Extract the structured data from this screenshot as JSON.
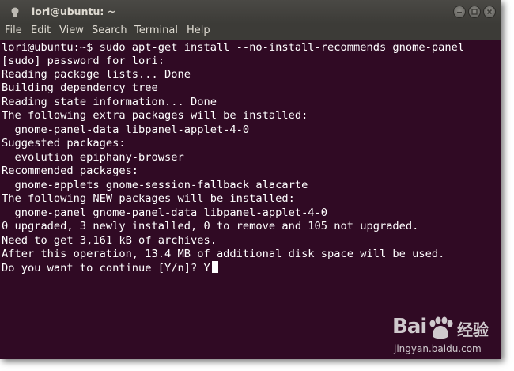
{
  "window": {
    "title": "lori@ubuntu: ~",
    "buttons": {
      "minimize": "minimize-icon",
      "maximize": "maximize-icon",
      "close": "close-icon"
    }
  },
  "menu": [
    "File",
    "Edit",
    "View",
    "Search",
    "Terminal",
    "Help"
  ],
  "terminal": {
    "lines": [
      "lori@ubuntu:~$ sudo apt-get install --no-install-recommends gnome-panel",
      "[sudo] password for lori:",
      "Reading package lists... Done",
      "Building dependency tree",
      "Reading state information... Done",
      "The following extra packages will be installed:",
      "  gnome-panel-data libpanel-applet-4-0",
      "Suggested packages:",
      "  evolution epiphany-browser",
      "Recommended packages:",
      "  gnome-applets gnome-session-fallback alacarte",
      "The following NEW packages will be installed:",
      "  gnome-panel gnome-panel-data libpanel-applet-4-0",
      "0 upgraded, 3 newly installed, 0 to remove and 105 not upgraded.",
      "Need to get 3,161 kB of archives.",
      "After this operation, 13.4 MB of additional disk space will be used.",
      "Do you want to continue [Y/n]? Y"
    ]
  },
  "watermark": {
    "brand": "Bai",
    "brand_suffix": "经验",
    "url": "jingyan.baidu.com"
  },
  "colors": {
    "terminal_bg": "#300a24",
    "titlebar_bg": "#3c3b37",
    "text": "#ffffff"
  }
}
